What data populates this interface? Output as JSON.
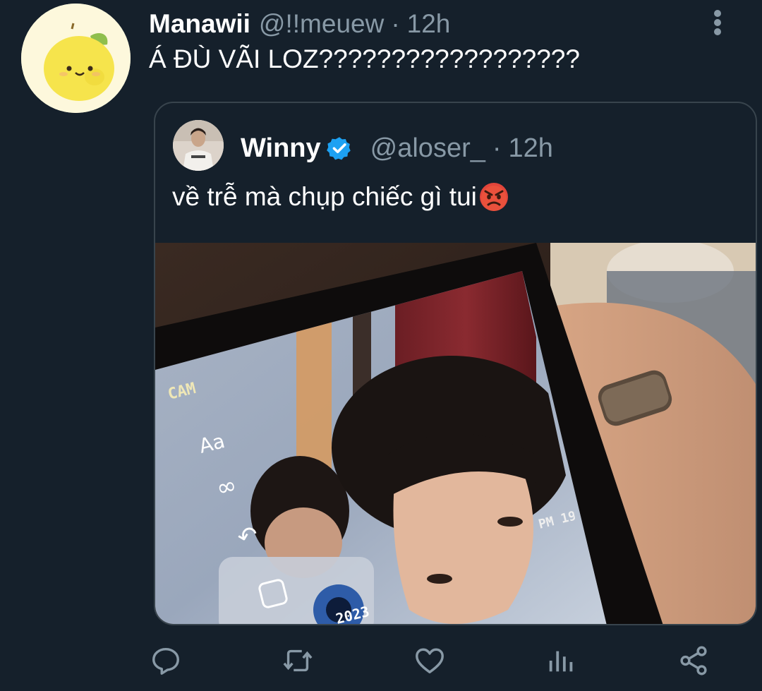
{
  "tweet": {
    "author": {
      "name": "Manawii",
      "handle": "@!!meuew",
      "separator": "·",
      "time": "12h"
    },
    "text": "Á ĐÙ VÃI LOZ??????????????????",
    "avatar_icon": "lemon-avatar-icon",
    "more_icon": "more-vertical-icon"
  },
  "quote": {
    "author": {
      "name": "Winny",
      "handle": "@aloser_",
      "separator": "·",
      "time": "12h",
      "verified": true
    },
    "text": "về trễ mà chụp chiếc gì tui",
    "emoji": "angry-face-emoji",
    "media": {
      "description_icon": "photo-of-phone-screen",
      "overlay_texts": {
        "cam": "CAM",
        "aa": "Aa",
        "infinity": "∞",
        "timestamp": "PM 19:27",
        "year": "2023"
      }
    }
  },
  "actions": [
    {
      "name": "reply",
      "icon": "reply-icon"
    },
    {
      "name": "retweet",
      "icon": "retweet-icon"
    },
    {
      "name": "like",
      "icon": "heart-icon"
    },
    {
      "name": "analytics",
      "icon": "analytics-icon"
    },
    {
      "name": "share",
      "icon": "share-icon"
    }
  ],
  "colors": {
    "background": "#15202b",
    "secondary_text": "#8899a6",
    "border": "#38444d",
    "verified": "#1da1f2"
  }
}
